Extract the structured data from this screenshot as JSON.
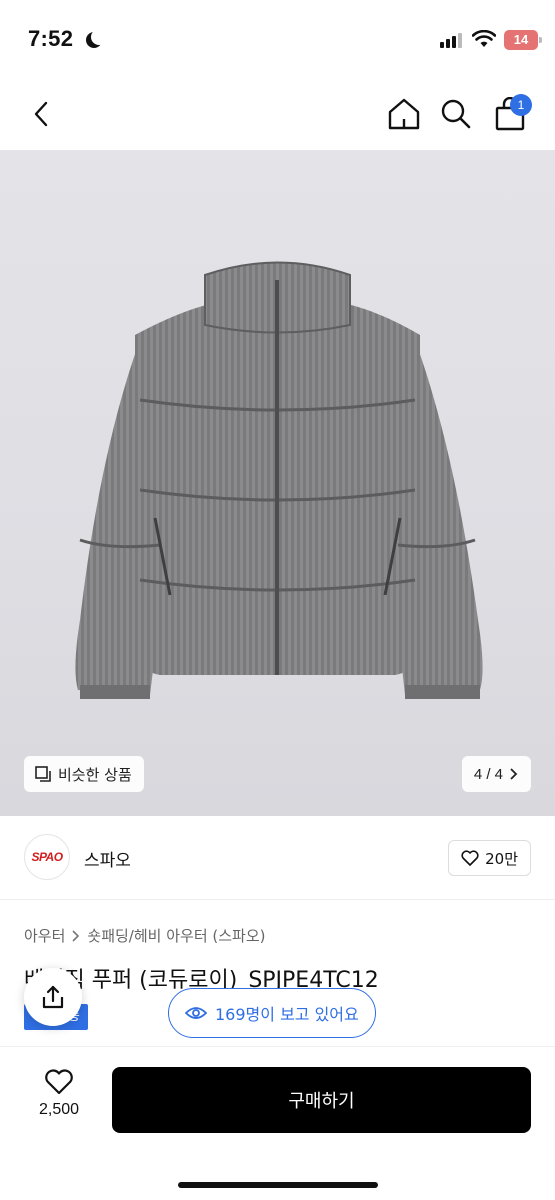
{
  "status_bar": {
    "time": "7:52",
    "battery": "14",
    "icons": [
      "moon-icon",
      "signal-icon",
      "wifi-icon",
      "battery-icon"
    ]
  },
  "nav": {
    "icons": [
      "back-arrow-icon",
      "home-icon",
      "search-icon",
      "shopping-bag-icon"
    ],
    "cart_badge": "1",
    "accent_color": "#2f6fe4"
  },
  "gallery": {
    "similar_label": "비슷한 상품",
    "page_counter": "4 / 4"
  },
  "shop": {
    "logo_text": "SPAO",
    "name": "스파오",
    "like_count": "20만"
  },
  "breadcrumb": {
    "items": [
      "아우터",
      "숏패딩/헤비 아우터 (스파오)"
    ]
  },
  "product": {
    "title": "베이직 푸퍼 (코듀로이)_SPJPE4TC12",
    "tag": "무료배송"
  },
  "viewers": {
    "text": "169명이 보고 있어요"
  },
  "bottom_bar": {
    "wish_count": "2,500",
    "buy_label": "구매하기"
  }
}
